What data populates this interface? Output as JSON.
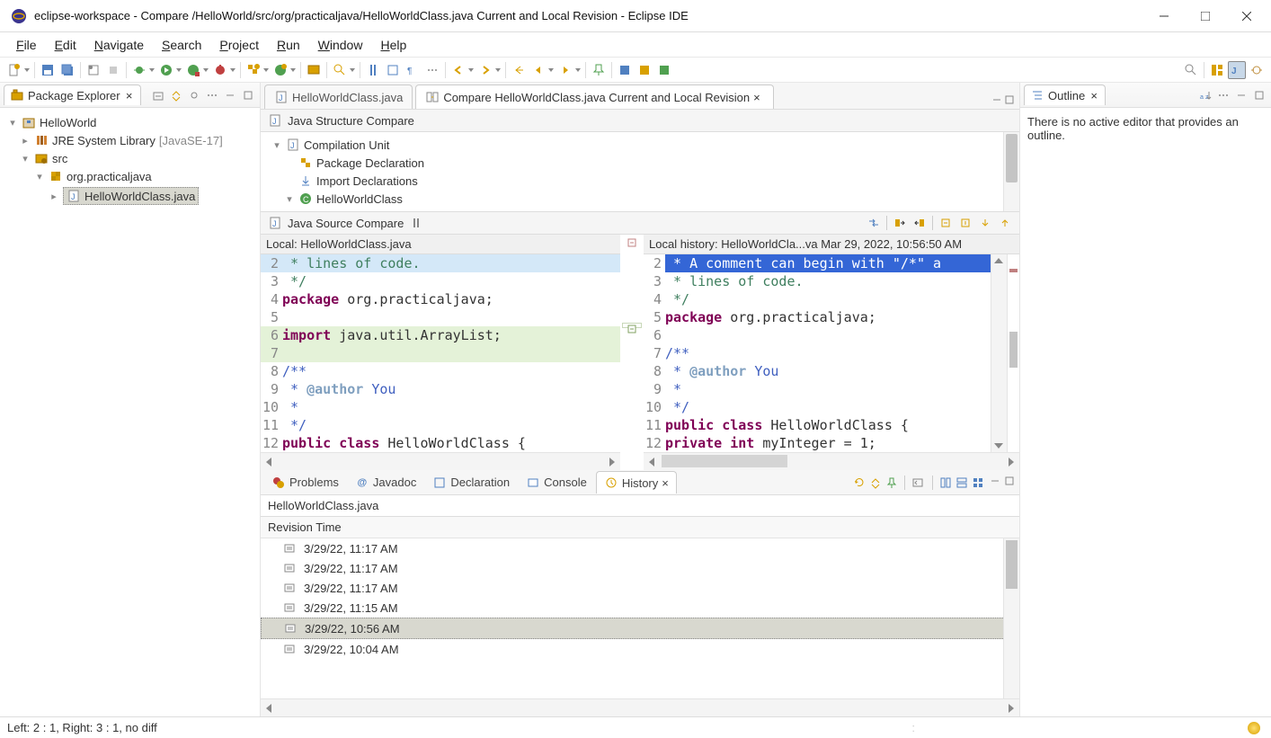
{
  "titlebar": {
    "title": "eclipse-workspace - Compare /HelloWorld/src/org/practicaljava/HelloWorldClass.java Current and Local Revision - Eclipse IDE"
  },
  "menubar": [
    "File",
    "Edit",
    "Navigate",
    "Search",
    "Project",
    "Run",
    "Window",
    "Help"
  ],
  "packageExplorer": {
    "title": "Package Explorer",
    "project": "HelloWorld",
    "jre": "JRE System Library",
    "jreVersion": "[JavaSE-17]",
    "src": "src",
    "pkg": "org.practicaljava",
    "file": "HelloWorldClass.java"
  },
  "editorTabs": {
    "tab1": "HelloWorldClass.java",
    "tab2": "Compare HelloWorldClass.java Current and Local Revision"
  },
  "structure": {
    "title": "Java Structure Compare",
    "n1": "Compilation Unit",
    "n2": "Package Declaration",
    "n3": "Import Declarations",
    "n4": "HelloWorldClass"
  },
  "sourceCompare": {
    "title": "Java Source Compare",
    "leftHeader": "Local: HelloWorldClass.java",
    "rightHeader": "Local history: HelloWorldCla...va Mar 29, 2022, 10:56:50 AM"
  },
  "leftCode": {
    "l2": " * lines of code.",
    "l3": " */",
    "l4a": "package",
    "l4b": " org.practicaljava;",
    "l5": "",
    "l6a": "import",
    "l6b": " java.util.ArrayList;",
    "l7": "",
    "l8": "/**",
    "l9a": " * ",
    "l9b": "@author",
    "l9c": " You",
    "l10": " *",
    "l11": " */",
    "l12a": "public",
    "l12b": " class",
    "l12c": " HelloWorldClass {"
  },
  "rightCode": {
    "l2": " * A comment can begin with \"/*\" a",
    "l3": " * lines of code.",
    "l4": " */",
    "l5a": "package",
    "l5b": " org.practicaljava;",
    "l6": "",
    "l7": "/**",
    "l8a": " * ",
    "l8b": "@author",
    "l8c": " You",
    "l9": " *",
    "l10": " */",
    "l11a": "public",
    "l11b": " class",
    "l11c": " HelloWorldClass {",
    "l12a": "private",
    "l12b": " int",
    "l12c": " myInteger = 1;"
  },
  "leftLineNums": {
    "l2": "2",
    "l3": "3",
    "l4": "4",
    "l5": "5",
    "l6": "6",
    "l7": "7",
    "l8": "8",
    "l9": "9",
    "l10": "10",
    "l11": "11",
    "l12": "12"
  },
  "rightLineNums": {
    "l2": "2",
    "l3": "3",
    "l4": "4",
    "l5": "5",
    "l6": "6",
    "l7": "7",
    "l8": "8",
    "l9": "9",
    "l10": "10",
    "l11": "11",
    "l12": "12"
  },
  "outline": {
    "title": "Outline",
    "empty": "There is no active editor that provides an outline."
  },
  "bottomTabs": {
    "problems": "Problems",
    "javadoc": "Javadoc",
    "decl": "Declaration",
    "console": "Console",
    "history": "History"
  },
  "history": {
    "file": "HelloWorldClass.java",
    "col": "Revision Time",
    "rows": [
      "3/29/22, 11:17 AM",
      "3/29/22, 11:17 AM",
      "3/29/22, 11:17 AM",
      "3/29/22, 11:15 AM",
      "3/29/22, 10:56 AM",
      "3/29/22, 10:04 AM"
    ],
    "selectedIndex": 4
  },
  "statusbar": {
    "text": "Left: 2 : 1, Right: 3 : 1, no diff"
  }
}
